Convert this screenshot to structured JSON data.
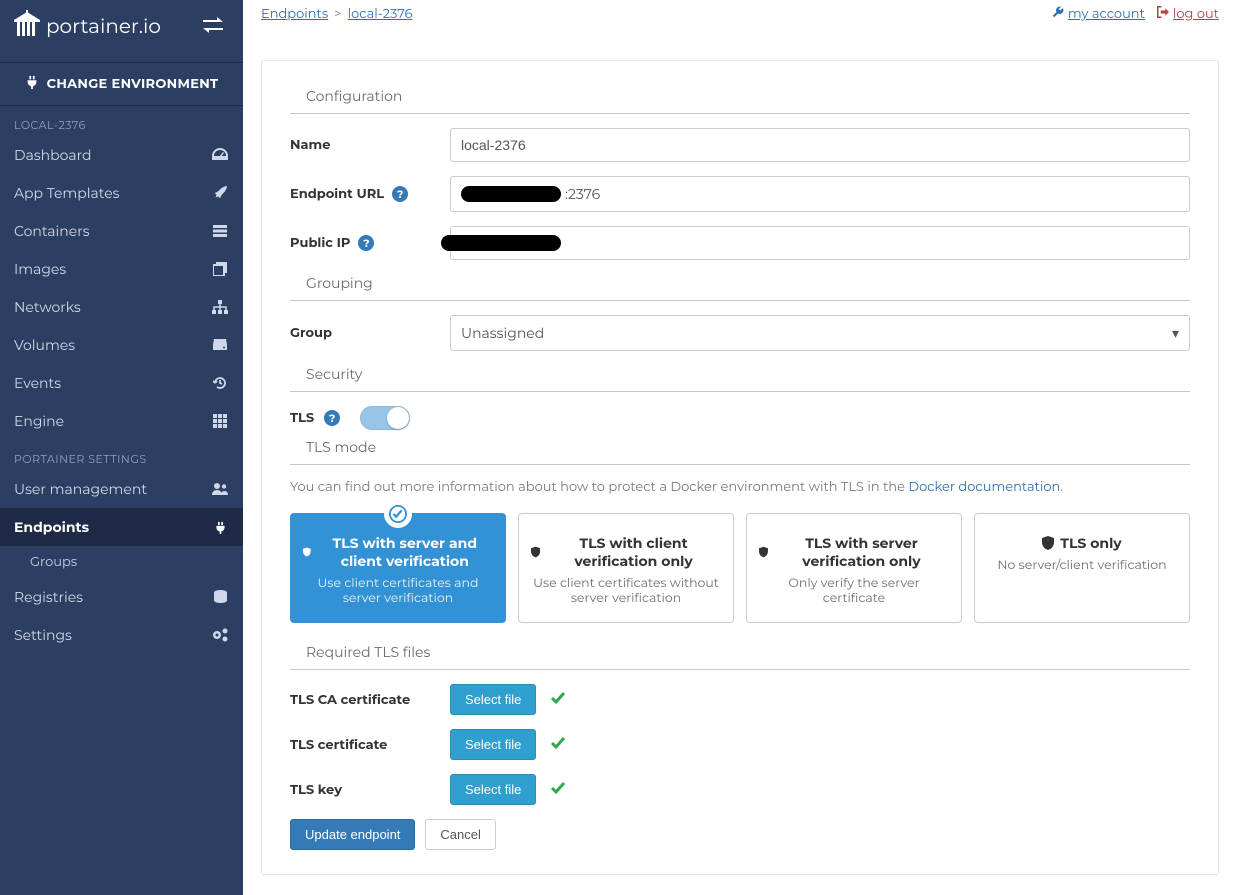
{
  "brand": {
    "name": "portainer.io"
  },
  "change_env": "CHANGE ENVIRONMENT",
  "nav": {
    "section1": "LOCAL-2376",
    "dashboard": "Dashboard",
    "app_templates": "App Templates",
    "containers": "Containers",
    "images": "Images",
    "networks": "Networks",
    "volumes": "Volumes",
    "events": "Events",
    "engine": "Engine",
    "section2": "PORTAINER SETTINGS",
    "user_mgmt": "User management",
    "endpoints": "Endpoints",
    "groups": "Groups",
    "registries": "Registries",
    "settings": "Settings"
  },
  "breadcrumb": {
    "root": "Endpoints",
    "current": "local-2376"
  },
  "toplinks": {
    "account": "my account",
    "logout": "log out"
  },
  "section": {
    "config": "Configuration",
    "grouping": "Grouping",
    "security": "Security",
    "tls_mode": "TLS mode",
    "tls_files": "Required TLS files"
  },
  "labels": {
    "name": "Name",
    "endpoint_url": "Endpoint URL",
    "public_ip": "Public IP",
    "group": "Group",
    "tls": "TLS",
    "tls_ca": "TLS CA certificate",
    "tls_cert": "TLS certificate",
    "tls_key": "TLS key"
  },
  "values": {
    "name": "local-2376",
    "endpoint_url_suffix": ":2376",
    "group": "Unassigned"
  },
  "tls_info": {
    "pre": "You can find out more information about how to protect a Docker environment with TLS in the ",
    "link": "Docker documentation",
    "post": "."
  },
  "tls_modes": [
    {
      "title": "TLS with server and client verification",
      "desc": "Use client certificates and server verification",
      "selected": true
    },
    {
      "title": "TLS with client verification only",
      "desc": "Use client certificates without server verification",
      "selected": false
    },
    {
      "title": "TLS with server verification only",
      "desc": "Only verify the server certificate",
      "selected": false
    },
    {
      "title": "TLS only",
      "desc": "No server/client verification",
      "selected": false
    }
  ],
  "buttons": {
    "select_file": "Select file",
    "update": "Update endpoint",
    "cancel": "Cancel"
  }
}
